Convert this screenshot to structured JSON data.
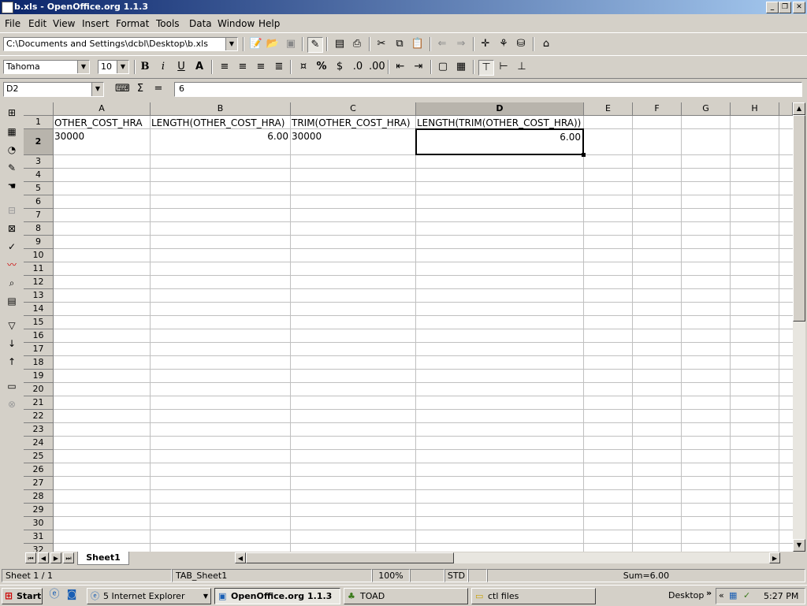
{
  "window": {
    "title": "b.xls - OpenOffice.org 1.1.3"
  },
  "menu": [
    "File",
    "Edit",
    "View",
    "Insert",
    "Format",
    "Tools",
    "Data",
    "Window",
    "Help"
  ],
  "toolbar": {
    "path": "C:\\Documents and Settings\\dcbl\\Desktop\\b.xls"
  },
  "format": {
    "font": "Tahoma",
    "size": "10"
  },
  "formula": {
    "cell_ref": "D2",
    "value": "6",
    "sum_symbol": "Σ",
    "equals_symbol": "="
  },
  "columns": [
    "A",
    "B",
    "C",
    "D",
    "E",
    "F",
    "G",
    "H"
  ],
  "rows": [
    "1",
    "2",
    "3",
    "4",
    "5",
    "6",
    "7",
    "8",
    "9",
    "10",
    "11",
    "12",
    "13",
    "14",
    "15",
    "16",
    "17",
    "18",
    "19",
    "20",
    "21",
    "22",
    "23",
    "24",
    "25",
    "26",
    "27",
    "28",
    "29",
    "30",
    "31",
    "32"
  ],
  "cells": {
    "A1": "OTHER_COST_HRA",
    "B1": "LENGTH(OTHER_COST_HRA)",
    "C1": "TRIM(OTHER_COST_HRA)",
    "D1": "LENGTH(TRIM(OTHER_COST_HRA))",
    "A2": "30000",
    "B2": "6.00",
    "C2": "30000",
    "D2": "6.00"
  },
  "sheet_tab": "Sheet1",
  "status": {
    "sheet": "Sheet 1 / 1",
    "page_style": "TAB_Sheet1",
    "zoom": "100%",
    "mode": "STD",
    "sum": "Sum=6.00"
  },
  "taskbar": {
    "start": "Start",
    "tasks": [
      "5 Internet Explorer",
      "OpenOffice.org 1.1.3",
      "TOAD",
      "ctl files"
    ],
    "desktop": "Desktop",
    "clock": "5:27 PM"
  },
  "colors": {
    "title_start": "#0a246a",
    "title_end": "#a6caf0",
    "face": "#d4d0c8"
  }
}
